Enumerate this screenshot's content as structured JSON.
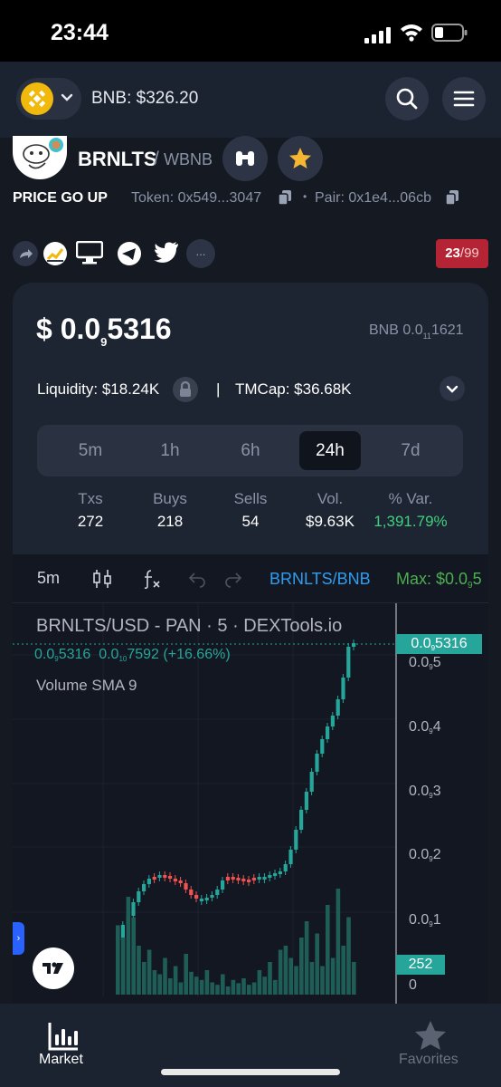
{
  "status": {
    "time": "23:44"
  },
  "nav": {
    "chain_price": "BNB: $326.20"
  },
  "token": {
    "name": "BRNLTS",
    "sep": "/",
    "quote": "WBNB",
    "description": "PRICE GO UP",
    "token_address": "Token: 0x549...3047",
    "pair_address": "Pair: 0x1e4...06cb",
    "more_label": "...",
    "score": "23",
    "score_max": "/99"
  },
  "price": {
    "usd_prefix": "$ 0.0",
    "usd_sub": "9",
    "usd_tail": "5316",
    "bnb_prefix": "BNB 0.0",
    "bnb_sub": "11",
    "bnb_tail": "1621"
  },
  "metrics": {
    "liquidity": "Liquidity: $18.24K",
    "divider": "|",
    "mcap": "TMCap: $36.68K"
  },
  "timeframes": [
    "5m",
    "1h",
    "6h",
    "24h",
    "7d"
  ],
  "active_timeframe": "24h",
  "stats": {
    "headers": [
      "Txs",
      "Buys",
      "Sells",
      "Vol.",
      "% Var."
    ],
    "values": [
      "272",
      "218",
      "54",
      "$9.63K",
      "1,391.79%"
    ]
  },
  "chart_toolbar": {
    "interval": "5m",
    "pair": "BRNLTS/BNB",
    "max_prefix": "Max: $0.0",
    "max_sub": "9",
    "max_tail": "5"
  },
  "chart": {
    "title": "BRNLTS/USD - PAN · 5 · DEXTools.io",
    "legend_a_prefix": "0.0",
    "legend_a_sub": "9",
    "legend_a_tail": "5316",
    "legend_b_prefix": "0.0",
    "legend_b_sub": "10",
    "legend_b_tail": "7592",
    "legend_change": "(+16.66%)",
    "volume_label": "Volume SMA 9",
    "price_tag_prefix": "0.0",
    "price_tag_sub": "9",
    "price_tag_tail": "5316",
    "axis": [
      {
        "prefix": "0.0",
        "sub": "9",
        "tail": "5"
      },
      {
        "prefix": "0.0",
        "sub": "9",
        "tail": "4"
      },
      {
        "prefix": "0.0",
        "sub": "9",
        "tail": "3"
      },
      {
        "prefix": "0.0",
        "sub": "9",
        "tail": "2"
      },
      {
        "prefix": "0.0",
        "sub": "9",
        "tail": "1"
      }
    ],
    "volume_tag": "252",
    "volume_zero": "0",
    "up_color": "#26a69a",
    "down_color": "#ef5350"
  },
  "tabs": {
    "market": "Market",
    "favorites": "Favorites"
  }
}
